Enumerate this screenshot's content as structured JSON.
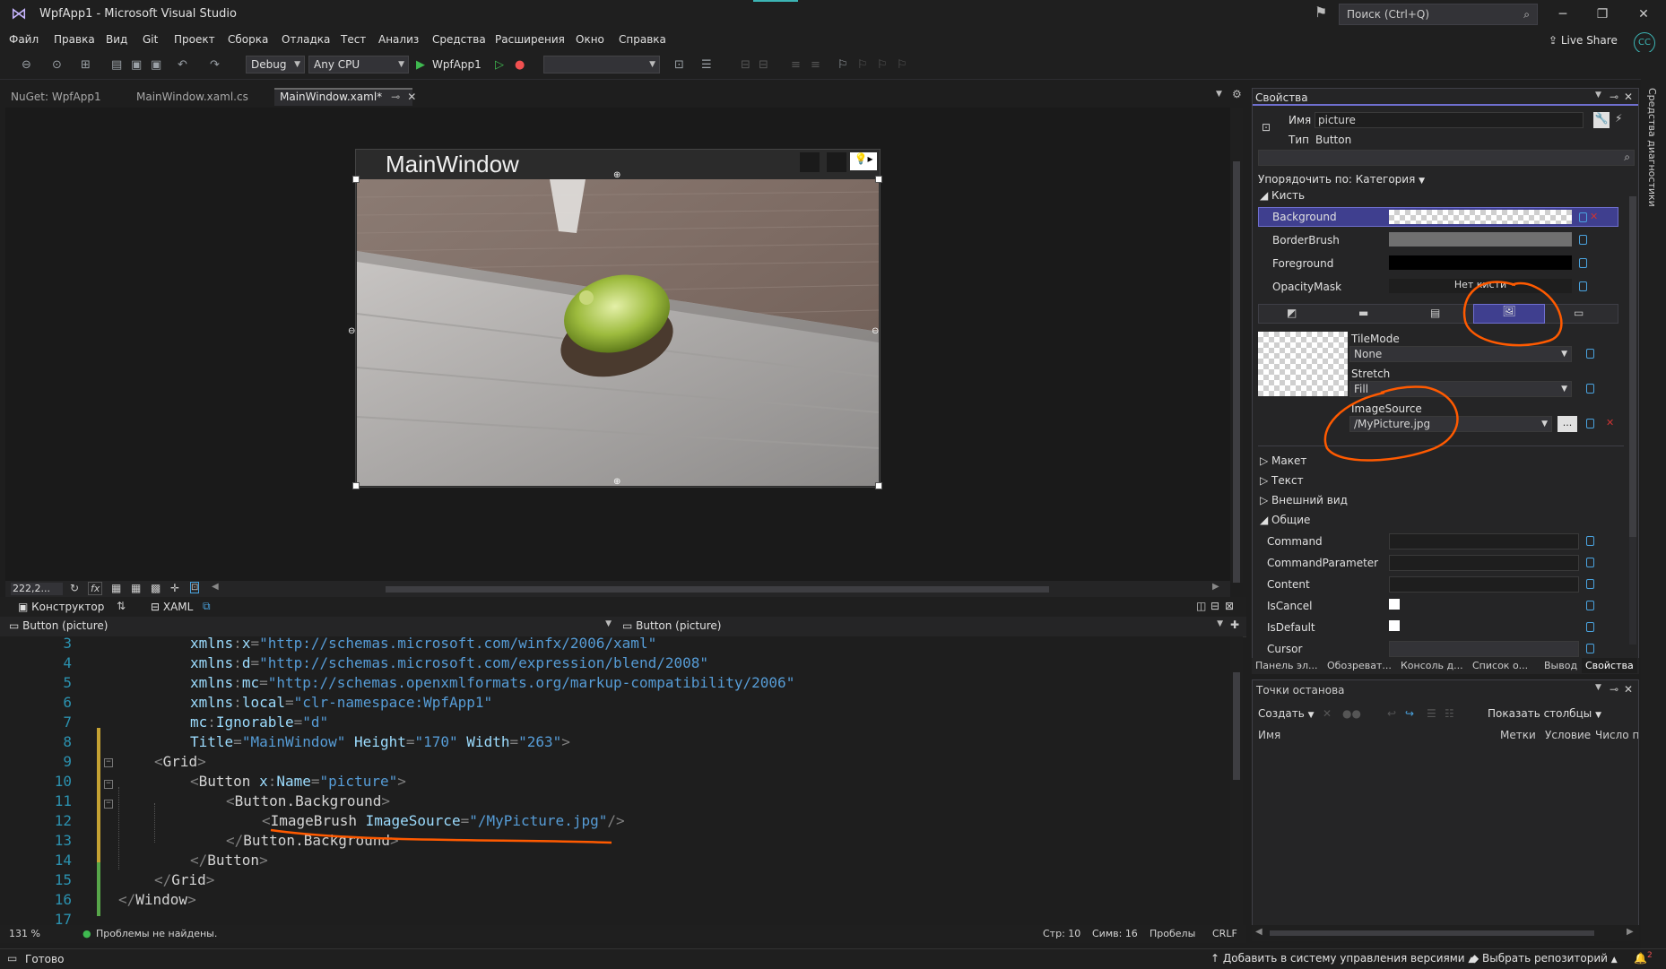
{
  "app": {
    "title": "WpfApp1 - Microsoft Visual Studio",
    "search_placeholder": "Поиск (Ctrl+Q)",
    "live_share": "Live Share",
    "avatar_initials": "CC"
  },
  "menu": [
    "Файл",
    "Правка",
    "Вид",
    "Git",
    "Проект",
    "Сборка",
    "Отладка",
    "Тест",
    "Анализ",
    "Средства",
    "Расширения",
    "Окно",
    "Справка"
  ],
  "toolbar": {
    "config": "Debug",
    "platform": "Any CPU",
    "run_target": "WpfApp1"
  },
  "doc_tabs": [
    "NuGet: WpfApp1",
    "MainWindow.xaml.cs",
    "MainWindow.xaml*"
  ],
  "designer": {
    "window_title": "MainWindow",
    "zoom_combo": "222,2...",
    "fx_label": "fx",
    "tab_designer": "Конструктор",
    "tab_xaml": "XAML",
    "nav_left": "Button (picture)",
    "nav_right": "Button (picture)"
  },
  "code": {
    "lines": [
      {
        "n": "3",
        "parts": [
          [
            "att",
            "xmlns"
          ],
          [
            "pun",
            ":"
          ],
          [
            "att",
            "x"
          ],
          [
            "pun",
            "="
          ],
          [
            "val",
            "\"http://schemas.microsoft.com/winfx/2006/xaml\""
          ]
        ]
      },
      {
        "n": "4",
        "parts": [
          [
            "att",
            "xmlns"
          ],
          [
            "pun",
            ":"
          ],
          [
            "att",
            "d"
          ],
          [
            "pun",
            "="
          ],
          [
            "val",
            "\"http://schemas.microsoft.com/expression/blend/2008\""
          ]
        ]
      },
      {
        "n": "5",
        "parts": [
          [
            "att",
            "xmlns"
          ],
          [
            "pun",
            ":"
          ],
          [
            "att",
            "mc"
          ],
          [
            "pun",
            "="
          ],
          [
            "val",
            "\"http://schemas.openxmlformats.org/markup-compatibility/2006\""
          ]
        ]
      },
      {
        "n": "6",
        "parts": [
          [
            "att",
            "xmlns"
          ],
          [
            "pun",
            ":"
          ],
          [
            "att",
            "local"
          ],
          [
            "pun",
            "="
          ],
          [
            "val",
            "\"clr-namespace:WpfApp1\""
          ]
        ]
      },
      {
        "n": "7",
        "parts": [
          [
            "att",
            "mc"
          ],
          [
            "pun",
            ":"
          ],
          [
            "att",
            "Ignorable"
          ],
          [
            "pun",
            "="
          ],
          [
            "val",
            "\"d\""
          ]
        ]
      },
      {
        "n": "8",
        "parts": [
          [
            "att",
            "Title"
          ],
          [
            "pun",
            "="
          ],
          [
            "val",
            "\"MainWindow\""
          ],
          [
            "tag",
            " "
          ],
          [
            "att",
            "Height"
          ],
          [
            "pun",
            "="
          ],
          [
            "val",
            "\"170\""
          ],
          [
            "tag",
            " "
          ],
          [
            "att",
            "Width"
          ],
          [
            "pun",
            "="
          ],
          [
            "val",
            "\"263\""
          ],
          [
            "pun",
            ">"
          ]
        ]
      },
      {
        "n": "9",
        "parts": [
          [
            "pun",
            "<"
          ],
          [
            "tag",
            "Grid"
          ],
          [
            "pun",
            ">"
          ]
        ]
      },
      {
        "n": "10",
        "parts": [
          [
            "pun",
            "<"
          ],
          [
            "tag",
            "Button"
          ],
          [
            "tag",
            " "
          ],
          [
            "att",
            "x"
          ],
          [
            "pun",
            ":"
          ],
          [
            "att",
            "Name"
          ],
          [
            "pun",
            "="
          ],
          [
            "val",
            "\"picture\""
          ],
          [
            "pun",
            ">"
          ]
        ]
      },
      {
        "n": "11",
        "parts": [
          [
            "pun",
            "<"
          ],
          [
            "tag",
            "Button.Background"
          ],
          [
            "pun",
            ">"
          ]
        ]
      },
      {
        "n": "12",
        "parts": [
          [
            "pun",
            "<"
          ],
          [
            "tag",
            "ImageBrush"
          ],
          [
            "tag",
            " "
          ],
          [
            "att",
            "ImageSource"
          ],
          [
            "pun",
            "="
          ],
          [
            "val",
            "\"/MyPicture.jpg\""
          ],
          [
            "pun",
            "/>"
          ]
        ]
      },
      {
        "n": "13",
        "parts": [
          [
            "pun",
            "</"
          ],
          [
            "tag",
            "Button.Background"
          ],
          [
            "pun",
            ">"
          ]
        ]
      },
      {
        "n": "14",
        "parts": [
          [
            "pun",
            "</"
          ],
          [
            "tag",
            "Button"
          ],
          [
            "pun",
            ">"
          ]
        ]
      },
      {
        "n": "15",
        "parts": [
          [
            "pun",
            "</"
          ],
          [
            "tag",
            "Grid"
          ],
          [
            "pun",
            ">"
          ]
        ]
      },
      {
        "n": "16",
        "parts": [
          [
            "pun",
            "</"
          ],
          [
            "tag",
            "Window"
          ],
          [
            "pun",
            ">"
          ]
        ]
      },
      {
        "n": "17",
        "parts": []
      }
    ]
  },
  "editor_status": {
    "zoom": "131 %",
    "problems": "Проблемы не найдены.",
    "line": "Стр: 10",
    "col": "Симв: 16",
    "spaces": "Пробелы",
    "eol": "CRLF"
  },
  "properties": {
    "panel_title": "Свойства",
    "name_label": "Имя",
    "name_value": "picture",
    "type_label": "Тип",
    "type_value": "Button",
    "sort_label": "Упорядочить по: Категория",
    "brush_section": "Кисть",
    "brush_rows": [
      "Background",
      "BorderBrush",
      "Foreground",
      "OpacityMask"
    ],
    "no_brush": "Нет кисти",
    "tilemode_label": "TileMode",
    "tilemode_value": "None",
    "stretch_label": "Stretch",
    "stretch_value": "Fill",
    "imagesource_label": "ImageSource",
    "imagesource_value": "/MyPicture.jpg",
    "browse": "...",
    "sections": [
      "Макет",
      "Текст",
      "Внешний вид"
    ],
    "common_section": "Общие",
    "common_rows": [
      "Command",
      "CommandParameter",
      "Content",
      "IsCancel",
      "IsDefault",
      "Cursor"
    ]
  },
  "bottom_tabs": [
    "Панель эл...",
    "Обозреват...",
    "Консоль д...",
    "Список о...",
    "Вывод",
    "Свойства"
  ],
  "breakpoints": {
    "title": "Точки останова",
    "create": "Создать",
    "show_columns": "Показать столбцы",
    "col_name": "Имя",
    "col_labels": "Метки",
    "col_condition": "Условие",
    "col_hitcount": "Число п"
  },
  "side_label": "Средства диагностики",
  "status": {
    "ready": "Готово",
    "vcs": "Добавить в систему управления версиями",
    "repo": "Выбрать репозиторий",
    "notifications": "2"
  }
}
